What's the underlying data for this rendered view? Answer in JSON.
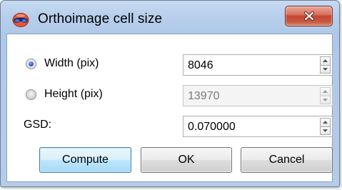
{
  "window": {
    "title": "Orthoimage cell size",
    "app_icon": "red-blue-3d-glasses-icon",
    "close_icon": "close-x-icon"
  },
  "fields": {
    "width": {
      "label": "Width (pix)",
      "value": "8046",
      "selected": true,
      "enabled": true
    },
    "height": {
      "label": "Height (pix)",
      "value": "13970",
      "selected": false,
      "enabled": false
    },
    "gsd": {
      "label": "GSD:",
      "value": "0.070000",
      "enabled": true
    }
  },
  "buttons": {
    "compute": "Compute",
    "ok": "OK",
    "cancel": "Cancel"
  },
  "colors": {
    "title_close_red": "#c4452f",
    "default_button_border": "#3c7fb1",
    "window_frame": "#b9d0ec"
  }
}
